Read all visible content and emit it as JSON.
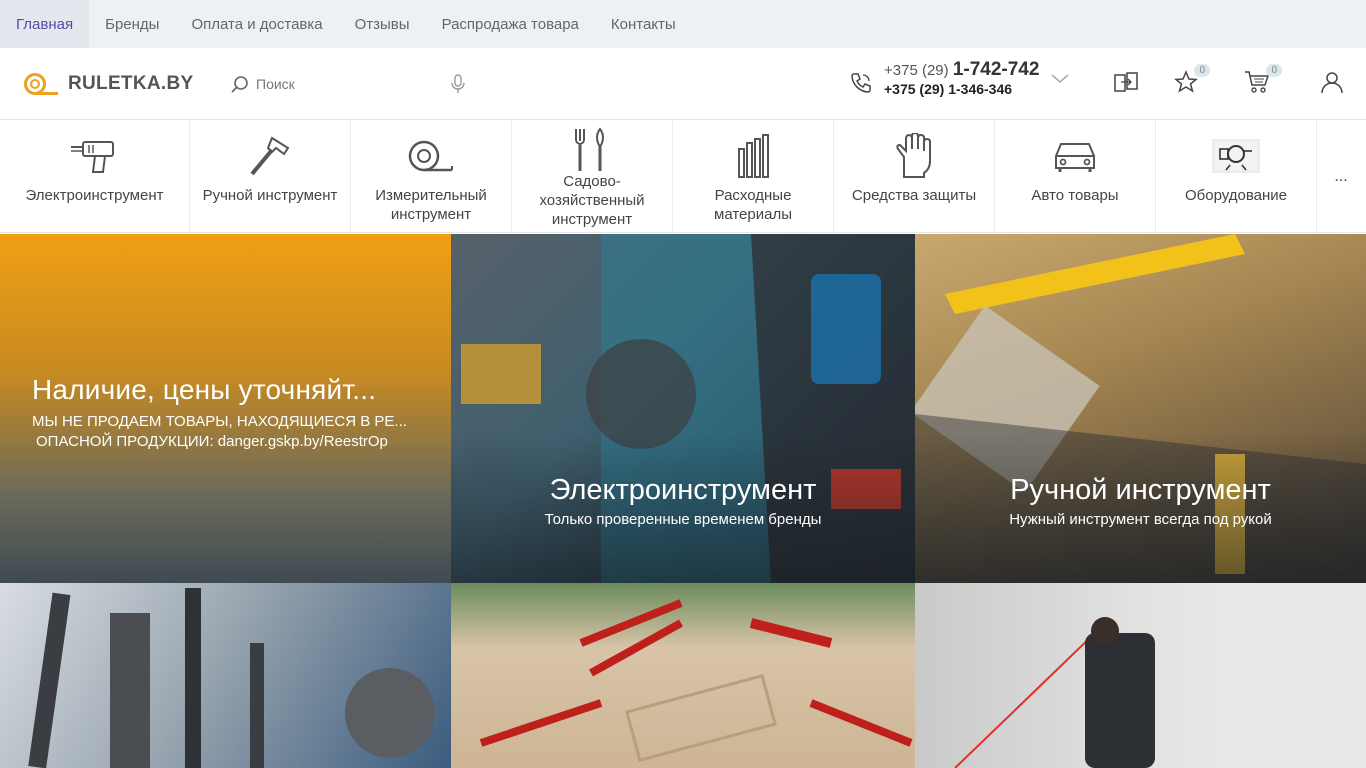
{
  "topnav": {
    "items": [
      {
        "label": "Главная",
        "active": true
      },
      {
        "label": "Бренды"
      },
      {
        "label": "Оплата и доставка"
      },
      {
        "label": "Отзывы"
      },
      {
        "label": "Распродажа товара"
      },
      {
        "label": "Контакты"
      }
    ]
  },
  "header": {
    "logo_text": "RULETKA.BY",
    "search_placeholder": "Поиск",
    "phone1_prefix": "+375 (29)",
    "phone1_number": "1-742-742",
    "phone2": "+375 (29) 1-346-346",
    "compare_count": "",
    "favorites_count": "0",
    "cart_count": "0",
    "accent_color": "#f0a01e"
  },
  "categories": [
    {
      "label": "Электроинструмент",
      "icon": "drill-icon"
    },
    {
      "label": "Ручной инструмент",
      "icon": "hammer-icon"
    },
    {
      "label": "Измерительный инструмент",
      "icon": "tape-measure-icon"
    },
    {
      "label": "Садово-хозяйственный инструмент",
      "icon": "garden-tools-icon"
    },
    {
      "label": "Расходные материалы",
      "icon": "drill-bits-icon"
    },
    {
      "label": "Средства защиты",
      "icon": "glove-icon"
    },
    {
      "label": "Авто товары",
      "icon": "car-icon"
    },
    {
      "label": "Оборудование",
      "icon": "equipment-icon"
    }
  ],
  "more_label": "...",
  "banners": {
    "promo_title": "Наличие, цены уточняйт...",
    "promo_line1": "МЫ НЕ ПРОДАЕМ ТОВАРЫ, НАХОДЯЩИЕСЯ В РЕ...",
    "promo_line2": "ОПАСНОЙ ПРОДУКЦИИ: danger.gskp.by/ReestrOp",
    "power_title": "Электроинструмент",
    "power_sub": "Только проверенные временем бренды",
    "hand_title": "Ручной инструмент",
    "hand_sub": "Нужный инструмент всегда под рукой"
  }
}
